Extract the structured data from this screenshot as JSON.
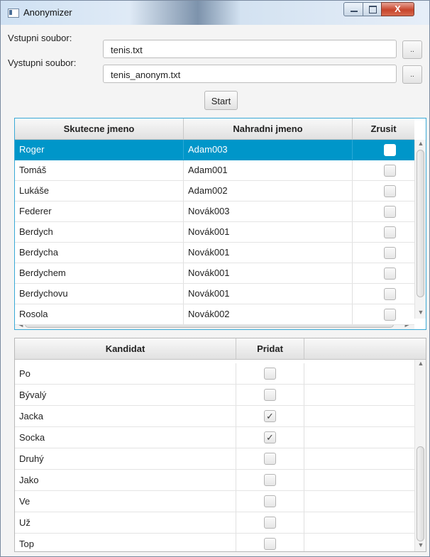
{
  "window": {
    "title": "Anonymizer",
    "close_glyph": "X"
  },
  "input_file": {
    "label": "Vstupni soubor:",
    "value": "tenis.txt",
    "browse_label": ".."
  },
  "output_file": {
    "label": "Vystupni soubor:",
    "value": "tenis_anonym.txt",
    "browse_label": ".."
  },
  "start_label": "Start",
  "names_table": {
    "columns": [
      "Skutecne jmeno",
      "Nahradni jmeno",
      "Zrusit"
    ],
    "rows": [
      {
        "real": "Roger",
        "replacement": "Adam003",
        "cancel": false,
        "selected": true
      },
      {
        "real": "Tomáš",
        "replacement": "Adam001",
        "cancel": false
      },
      {
        "real": "Lukáše",
        "replacement": "Adam002",
        "cancel": false
      },
      {
        "real": "Federer",
        "replacement": "Novák003",
        "cancel": false
      },
      {
        "real": "Berdych",
        "replacement": "Novák001",
        "cancel": false
      },
      {
        "real": "Berdycha",
        "replacement": "Novák001",
        "cancel": false
      },
      {
        "real": "Berdychem",
        "replacement": "Novák001",
        "cancel": false
      },
      {
        "real": "Berdychovu",
        "replacement": "Novák001",
        "cancel": false
      },
      {
        "real": "Rosola",
        "replacement": "Novák002",
        "cancel": false
      }
    ]
  },
  "candidates_table": {
    "columns": [
      "Kandidat",
      "Pridat"
    ],
    "rows": [
      {
        "candidate": "Po",
        "add": false
      },
      {
        "candidate": "Bývalý",
        "add": false
      },
      {
        "candidate": "Jacka",
        "add": true
      },
      {
        "candidate": "Socka",
        "add": true
      },
      {
        "candidate": "Druhý",
        "add": false
      },
      {
        "candidate": "Jako",
        "add": false
      },
      {
        "candidate": "Ve",
        "add": false
      },
      {
        "candidate": "Už",
        "add": false
      },
      {
        "candidate": "Top",
        "add": false
      }
    ]
  },
  "icons": {
    "app": "app-window-icon",
    "check_glyph": "✓",
    "scroll_up": "▲",
    "scroll_down": "▼",
    "scroll_left": "◀",
    "scroll_right": "▶"
  },
  "colors": {
    "selection": "#0096c9",
    "focus_border": "#39a9d6"
  }
}
